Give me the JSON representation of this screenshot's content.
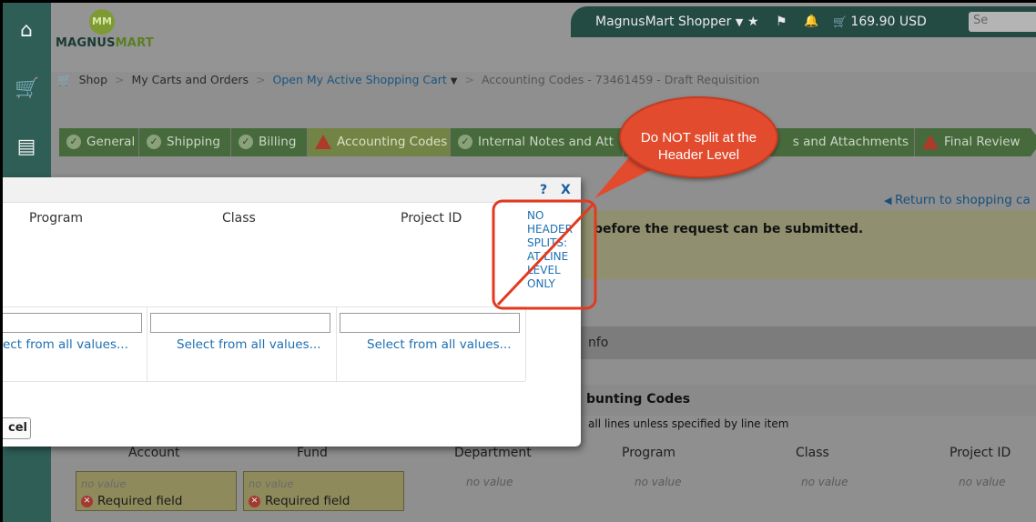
{
  "sidebar": {
    "icons": [
      "home-icon",
      "cart-icon",
      "documents-icon"
    ]
  },
  "logo": {
    "monogram": "MM",
    "text_a": "MAGNUS",
    "text_b": "MART"
  },
  "userbar": {
    "user": "MagnusMart Shopper",
    "user_caret": "▼",
    "star": "★",
    "flag": "⚑",
    "bell": "🔔",
    "cart_total": "169.90 USD",
    "search_placeholder": "Se"
  },
  "breadcrumb": {
    "cart_glyph": "🛒",
    "shop": "Shop",
    "sep": ">",
    "carts": "My Carts and Orders",
    "active": "Open My Active Shopping Cart",
    "caret": "▼",
    "current": "Accounting Codes - 73461459 - Draft Requisition"
  },
  "tabs": {
    "general": "General",
    "shipping": "Shipping",
    "billing": "Billing",
    "accounting": "Accounting Codes",
    "internal": "Internal Notes and Att",
    "external": "s and Attachments",
    "review": "Final Review",
    "check_glyph": "✓"
  },
  "page": {
    "return_link": "Return to shopping ca",
    "warning_text": "before the request can be submitted.",
    "info_band": "nfo",
    "section_title": "bunting Codes",
    "section_sub": "all lines unless specified by line item",
    "col_account": "Account",
    "col_fund": "Fund",
    "col_department": "Department",
    "col_program": "Program",
    "col_class": "Class",
    "col_project": "Project ID",
    "no_value": "no value",
    "required": "Required field"
  },
  "modal": {
    "help": "?",
    "close": "X",
    "col_program": "Program",
    "col_class": "Class",
    "col_project": "Project ID",
    "no_header_splits": "NO HEADER SPLITS: AT LINE LEVEL ONLY",
    "link1": "ect from all values...",
    "link2": "Select from all values...",
    "link3": "Select from all values...",
    "cancel": "cel"
  },
  "annotation": {
    "callout": "Do NOT split at the Header Level",
    "color": "#e23a1f"
  }
}
